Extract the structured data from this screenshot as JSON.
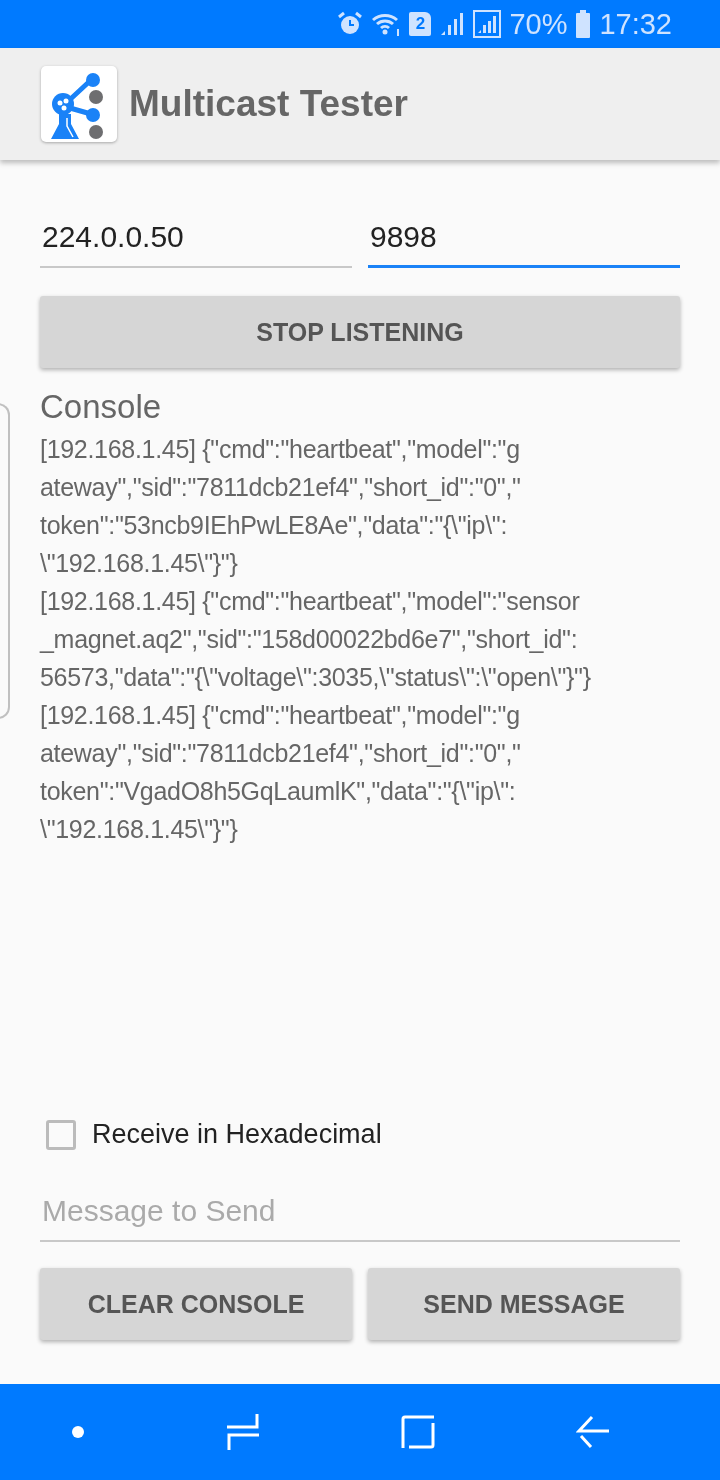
{
  "status_bar": {
    "sim_badge": "2",
    "battery": "70%",
    "time": "17:32"
  },
  "app_bar": {
    "title": "Multicast Tester"
  },
  "fields": [
    {
      "value": "224.0.0.50",
      "focused": false
    },
    {
      "value": "9898",
      "focused": true
    }
  ],
  "listen_button": {
    "label": "STOP LISTENING"
  },
  "console": {
    "title": "Console",
    "lines": [
      "[192.168.1.45] {\"cmd\":\"heartbeat\",\"model\":\"g",
      "ateway\",\"sid\":\"7811dcb21ef4\",\"short_id\":\"0\",\"",
      "token\":\"53ncb9IEhPwLE8Ae\",\"data\":\"{\\\"ip\\\":",
      "\\\"192.168.1.45\\\"}\"}",
      "[192.168.1.45] {\"cmd\":\"heartbeat\",\"model\":\"sensor",
      "_magnet.aq2\",\"sid\":\"158d00022bd6e7\",\"short_id\":",
      "56573,\"data\":\"{\\\"voltage\\\":3035,\\\"status\\\":\\\"open\\\"}\"}",
      "[192.168.1.45] {\"cmd\":\"heartbeat\",\"model\":\"g",
      "ateway\",\"sid\":\"7811dcb21ef4\",\"short_id\":\"0\",\"",
      "token\":\"VgadO8h5GqLaumlK\",\"data\":\"{\\\"ip\\\":",
      "\\\"192.168.1.45\\\"}\"}"
    ]
  },
  "hex_checkbox": {
    "label": "Receive in Hexadecimal",
    "checked": false
  },
  "message_field": {
    "placeholder": "Message to Send"
  },
  "buttons": [
    "CLEAR CONSOLE",
    "SEND MESSAGE"
  ]
}
